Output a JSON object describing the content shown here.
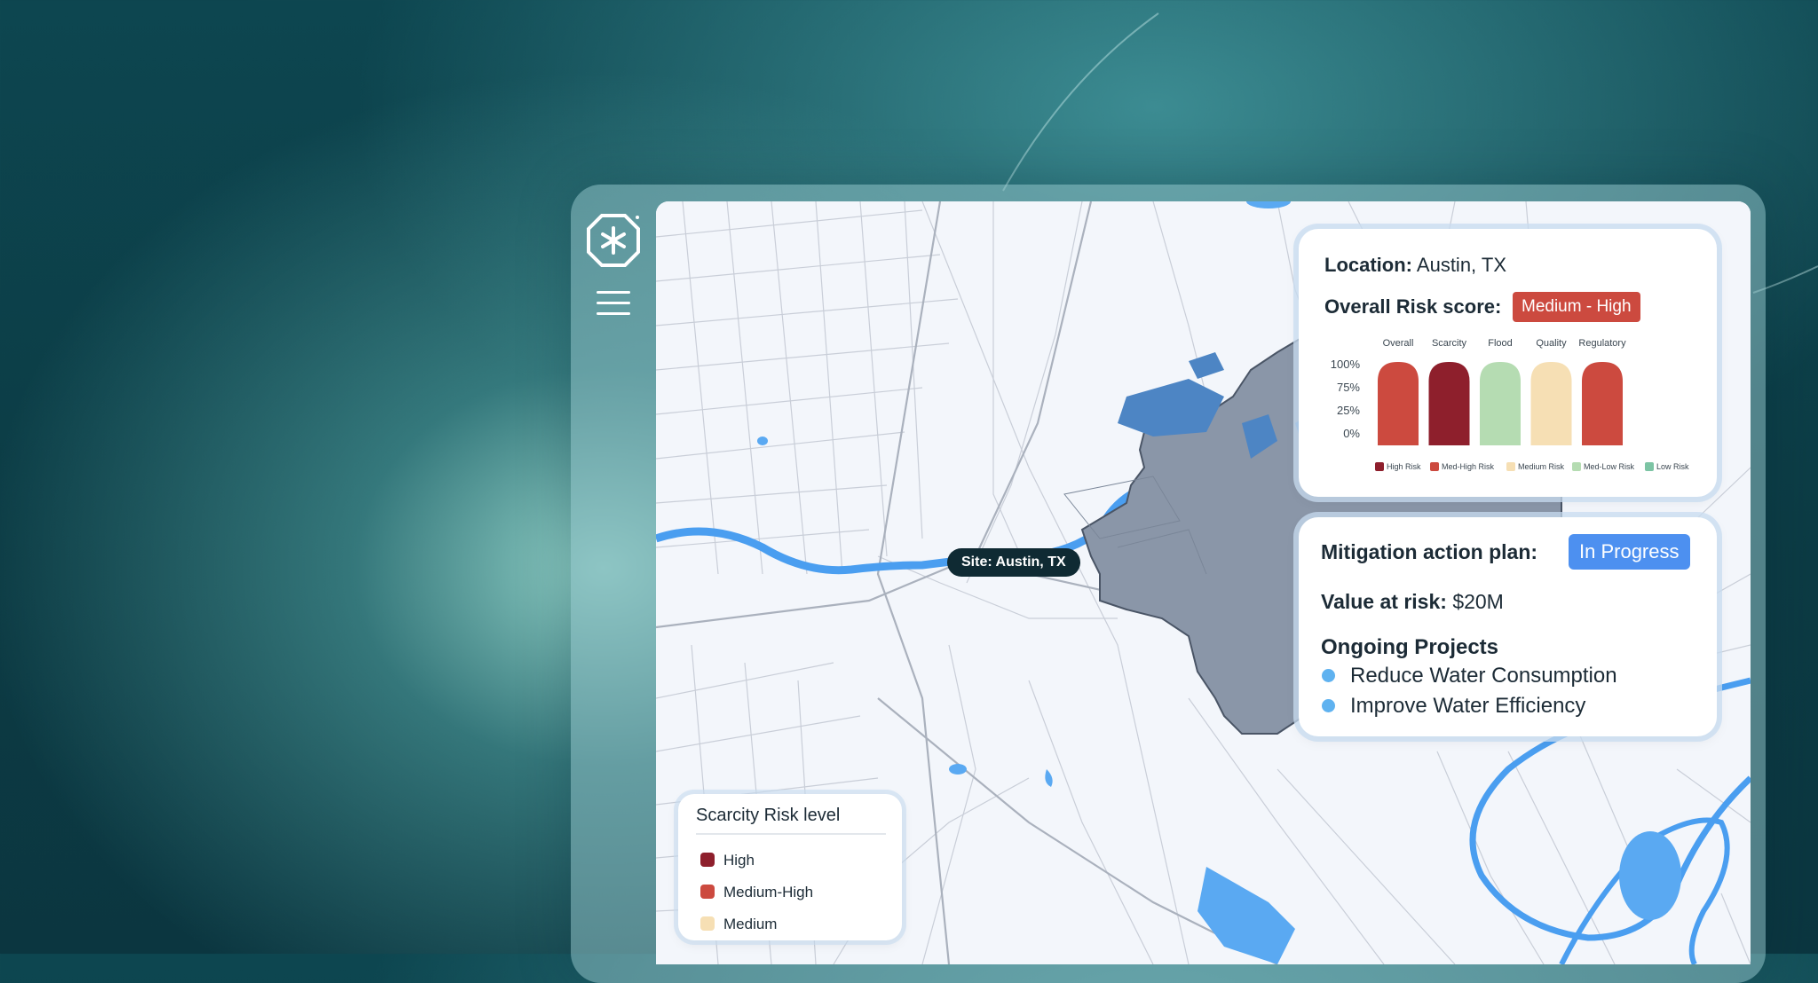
{
  "map": {
    "site_label": "Site: Austin, TX"
  },
  "risk_card": {
    "location_label": "Location:",
    "location_value": "Austin, TX",
    "score_label": "Overall Risk score:",
    "score_value": "Medium - High",
    "score_color": "#cc4a3f"
  },
  "chart_data": {
    "type": "bar",
    "categories": [
      "Overall",
      "Scarcity",
      "Flood",
      "Quality",
      "Regulatory"
    ],
    "values": [
      100,
      100,
      100,
      100,
      100
    ],
    "bar_colors": [
      "#cc4a3f",
      "#8e1f2c",
      "#b5dcb2",
      "#f6dfb4",
      "#cc4a3f"
    ],
    "y_ticks": [
      "100%",
      "75%",
      "25%",
      "0%"
    ],
    "ylim": [
      0,
      100
    ],
    "legend": [
      {
        "label": "High Risk",
        "color": "#8e1f2c"
      },
      {
        "label": "Med-High Risk",
        "color": "#cc4a3f"
      },
      {
        "label": "Medium Risk",
        "color": "#f6dfb4"
      },
      {
        "label": "Med-Low Risk",
        "color": "#b5dcb2"
      },
      {
        "label": "Low Risk",
        "color": "#7cc4a4"
      }
    ]
  },
  "mitigation_card": {
    "plan_label": "Mitigation action plan:",
    "plan_status": "In Progress",
    "value_label": "Value at risk:",
    "value_amount": "$20M",
    "projects_title": "Ongoing Projects",
    "projects": [
      "Reduce Water Consumption",
      "Improve Water Efficiency"
    ]
  },
  "scarcity_legend": {
    "title": "Scarcity Risk level",
    "items": [
      {
        "label": "High",
        "color": "#8e1f2c"
      },
      {
        "label": "Medium-High",
        "color": "#cc4a3f"
      },
      {
        "label": "Medium",
        "color": "#f6dfb4"
      }
    ]
  },
  "sidebar": {
    "menu_icon": "hamburger-menu-icon",
    "logo_icon": "asterisk-logo-icon"
  }
}
